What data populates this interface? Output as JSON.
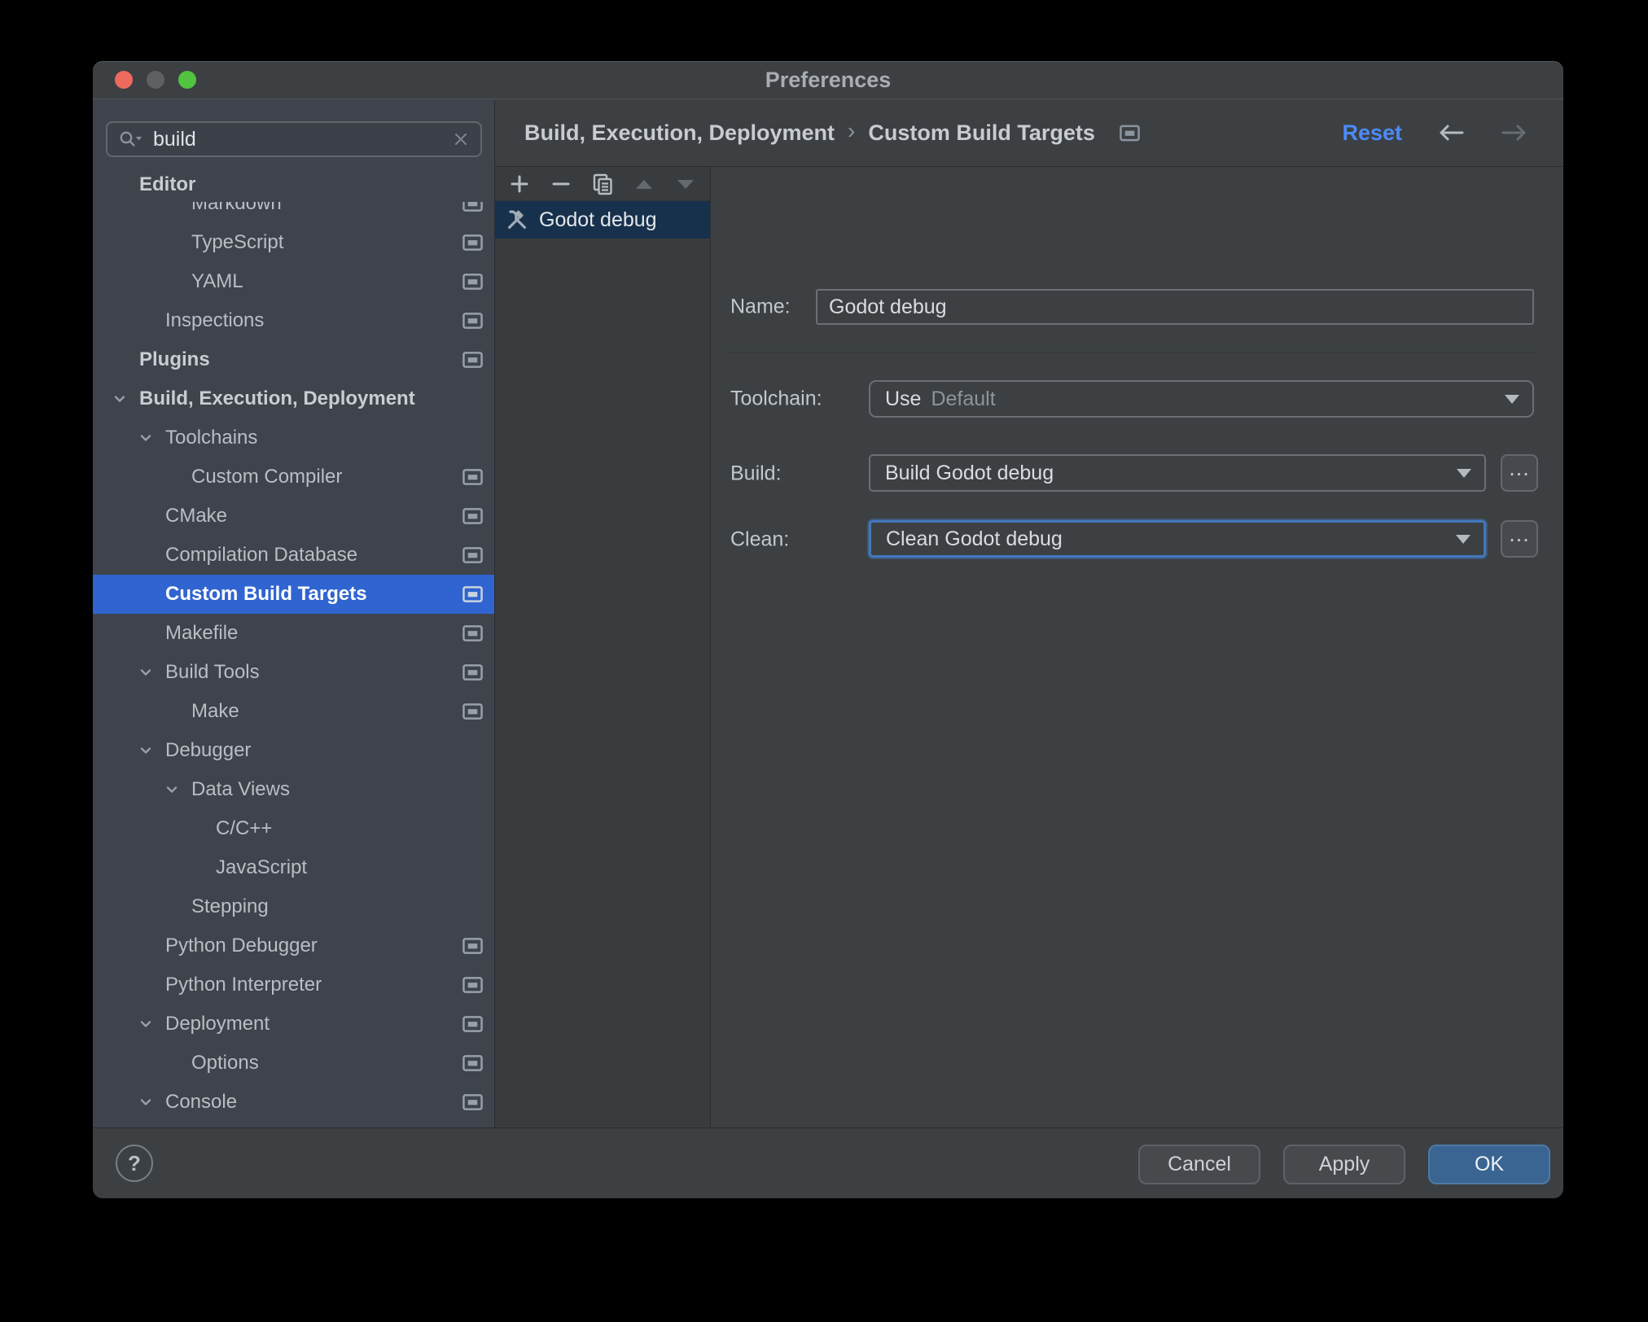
{
  "window": {
    "title": "Preferences"
  },
  "colors": {
    "selection_blue": "#3064d0",
    "list_selection_navy": "#17314d",
    "focus_blue": "#4278bd",
    "ok_button_blue": "#3a6492",
    "reset_link_blue": "#4d8af8",
    "traffic_red": "#ed6a5e",
    "traffic_gray": "#5d6164",
    "traffic_green": "#52c33e"
  },
  "sidebar": {
    "search": {
      "value": "build",
      "placeholder": ""
    },
    "tree": [
      {
        "label": "Editor",
        "indent": 57,
        "bold": true,
        "sticky": true,
        "chevron": false,
        "indicator": false,
        "selected": false
      },
      {
        "label": "Markdown",
        "indent": 121,
        "bold": false,
        "sticky": false,
        "chevron": false,
        "indicator": true,
        "selected": false
      },
      {
        "label": "TypeScript",
        "indent": 121,
        "bold": false,
        "sticky": false,
        "chevron": false,
        "indicator": true,
        "selected": false
      },
      {
        "label": "YAML",
        "indent": 121,
        "bold": false,
        "sticky": false,
        "chevron": false,
        "indicator": true,
        "selected": false
      },
      {
        "label": "Inspections",
        "indent": 89,
        "bold": false,
        "sticky": false,
        "chevron": false,
        "indicator": true,
        "selected": false
      },
      {
        "label": "Plugins",
        "indent": 57,
        "bold": true,
        "sticky": false,
        "chevron": false,
        "indicator": true,
        "selected": false
      },
      {
        "label": "Build, Execution, Deployment",
        "indent": 57,
        "bold": true,
        "sticky": false,
        "chevron": true,
        "indicator": false,
        "selected": false
      },
      {
        "label": "Toolchains",
        "indent": 89,
        "bold": false,
        "sticky": false,
        "chevron": true,
        "indicator": false,
        "selected": false
      },
      {
        "label": "Custom Compiler",
        "indent": 121,
        "bold": false,
        "sticky": false,
        "chevron": false,
        "indicator": true,
        "selected": false
      },
      {
        "label": "CMake",
        "indent": 89,
        "bold": false,
        "sticky": false,
        "chevron": false,
        "indicator": true,
        "selected": false
      },
      {
        "label": "Compilation Database",
        "indent": 89,
        "bold": false,
        "sticky": false,
        "chevron": false,
        "indicator": true,
        "selected": false
      },
      {
        "label": "Custom Build Targets",
        "indent": 89,
        "bold": false,
        "sticky": false,
        "chevron": false,
        "indicator": true,
        "selected": true
      },
      {
        "label": "Makefile",
        "indent": 89,
        "bold": false,
        "sticky": false,
        "chevron": false,
        "indicator": true,
        "selected": false
      },
      {
        "label": "Build Tools",
        "indent": 89,
        "bold": false,
        "sticky": false,
        "chevron": true,
        "indicator": true,
        "selected": false
      },
      {
        "label": "Make",
        "indent": 121,
        "bold": false,
        "sticky": false,
        "chevron": false,
        "indicator": true,
        "selected": false
      },
      {
        "label": "Debugger",
        "indent": 89,
        "bold": false,
        "sticky": false,
        "chevron": true,
        "indicator": false,
        "selected": false
      },
      {
        "label": "Data Views",
        "indent": 121,
        "bold": false,
        "sticky": false,
        "chevron": true,
        "indicator": false,
        "selected": false
      },
      {
        "label": "C/C++",
        "indent": 151,
        "bold": false,
        "sticky": false,
        "chevron": false,
        "indicator": false,
        "selected": false
      },
      {
        "label": "JavaScript",
        "indent": 151,
        "bold": false,
        "sticky": false,
        "chevron": false,
        "indicator": false,
        "selected": false
      },
      {
        "label": "Stepping",
        "indent": 121,
        "bold": false,
        "sticky": false,
        "chevron": false,
        "indicator": false,
        "selected": false
      },
      {
        "label": "Python Debugger",
        "indent": 89,
        "bold": false,
        "sticky": false,
        "chevron": false,
        "indicator": true,
        "selected": false
      },
      {
        "label": "Python Interpreter",
        "indent": 89,
        "bold": false,
        "sticky": false,
        "chevron": false,
        "indicator": true,
        "selected": false
      },
      {
        "label": "Deployment",
        "indent": 89,
        "bold": false,
        "sticky": false,
        "chevron": true,
        "indicator": true,
        "selected": false
      },
      {
        "label": "Options",
        "indent": 121,
        "bold": false,
        "sticky": false,
        "chevron": false,
        "indicator": true,
        "selected": false
      },
      {
        "label": "Console",
        "indent": 89,
        "bold": false,
        "sticky": false,
        "chevron": true,
        "indicator": true,
        "selected": false
      }
    ]
  },
  "header": {
    "breadcrumb": [
      "Build, Execution, Deployment",
      "Custom Build Targets"
    ],
    "breadcrumb_separator": "›",
    "reset_label": "Reset"
  },
  "list_panel": {
    "toolbar_icons": [
      "add",
      "remove",
      "copy",
      "move-up",
      "move-down"
    ],
    "items": [
      {
        "label": "Godot debug",
        "selected": true
      }
    ]
  },
  "form": {
    "name_label": "Name:",
    "name_value": "Godot debug",
    "toolchain_label": "Toolchain:",
    "toolchain_value": "Use",
    "toolchain_value_secondary": "Default",
    "build_label": "Build:",
    "build_value": "Build Godot debug",
    "clean_label": "Clean:",
    "clean_value": "Clean Godot debug",
    "more_label": "..."
  },
  "footer": {
    "help_label": "?",
    "cancel_label": "Cancel",
    "apply_label": "Apply",
    "ok_label": "OK"
  }
}
